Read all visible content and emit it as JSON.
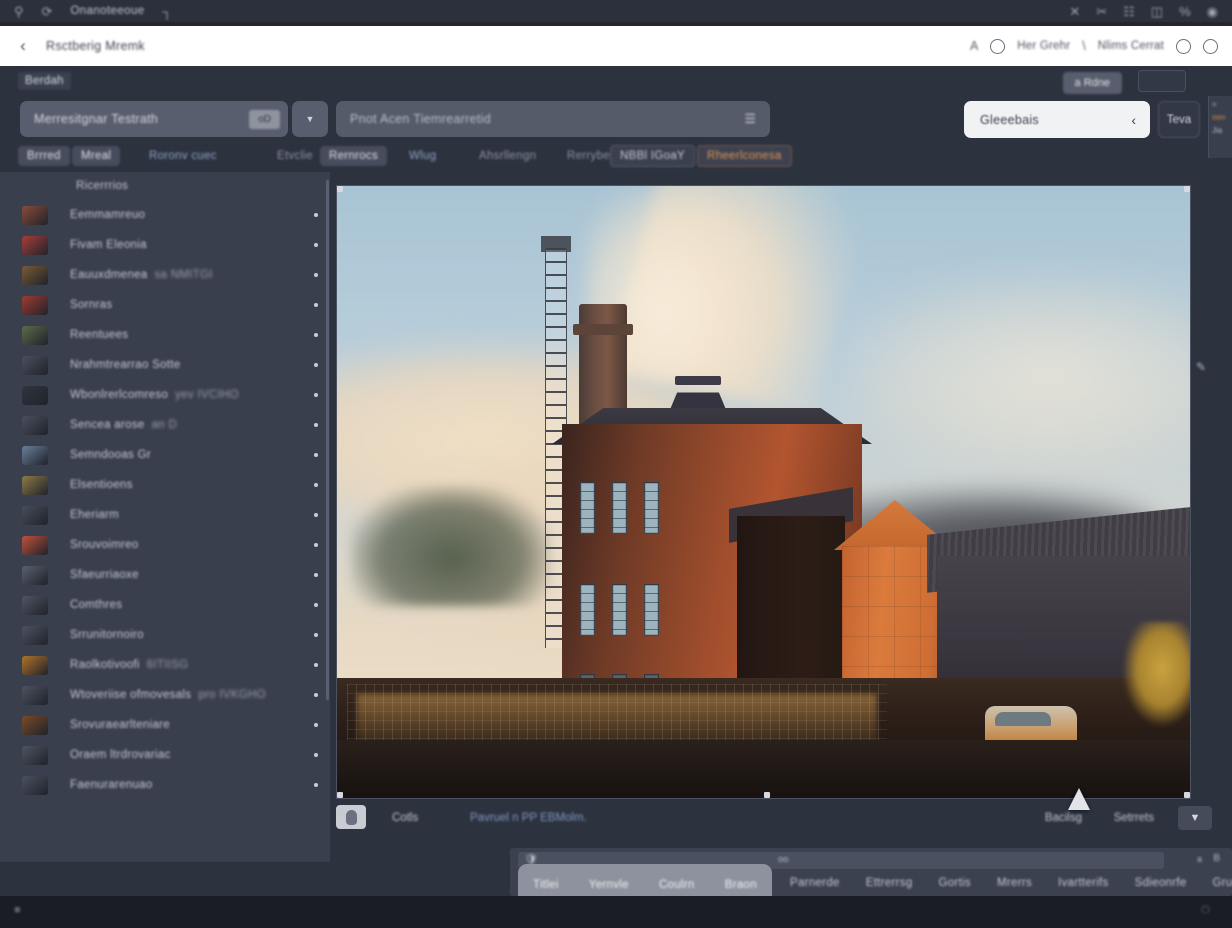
{
  "os_bar": {
    "icons": [
      "search-icon",
      "refresh-icon",
      "window-icon"
    ],
    "label": "Onanoteeoue",
    "right_icons": [
      "cut-icon",
      "scissors-icon",
      "copy-icon",
      "paste-icon",
      "percent-icon",
      "power-icon"
    ]
  },
  "chrome": {
    "back_icon": "chevron-left-icon",
    "title": "Rsctberig Mremk",
    "right": {
      "letter_icon": "A",
      "circle1": "circle-icon",
      "label1": "Her Grehr",
      "slash_icon": "slash-icon",
      "label2": "Nlims Cerrat",
      "circle2": "circle-icon",
      "circle3": "circle-icon"
    }
  },
  "breadcrumb": "Berdah",
  "top_right": {
    "pill": "a Rdne",
    "box": ""
  },
  "toolbar": {
    "search_placeholder": "Merresitgnar Testrath",
    "search_badge": "oD",
    "dropdown_caret": "chevron-down-icon",
    "filter_placeholder": "Pnot Acen Tiemrearretid",
    "filter_icon": "list-icon",
    "select_label": "Gleeebais",
    "select_chevron": "chevron-left-icon",
    "select_button": "Teva"
  },
  "tabs": [
    {
      "label": "Brrred",
      "style": "chip"
    },
    {
      "label": "Mreal",
      "style": "chip"
    },
    {
      "label": "Roronv cuec",
      "style": "link"
    },
    {
      "label": "Etvclie",
      "style": "dim"
    },
    {
      "label": "Rernrocs",
      "style": "chip"
    },
    {
      "label": "Wlug",
      "style": "link"
    },
    {
      "label": "Ahsrllengn",
      "style": "dim"
    },
    {
      "label": "Rerrybes",
      "style": "dim"
    },
    {
      "label": "NBBl IGoaY",
      "style": "outline"
    },
    {
      "label": "Rheerlconesa",
      "style": "accent"
    }
  ],
  "sidebar": {
    "header": "Ricerrrios",
    "items": [
      {
        "label": "Eemmamreuo",
        "thumb": "#8a4b3a",
        "has_thumb": true
      },
      {
        "label": "Fivam Eleonia",
        "thumb": "#a83d3a",
        "has_thumb": true
      },
      {
        "label": "Eauuxdmenea",
        "sub": "sa NMITGI",
        "thumb": "#7a5a34",
        "has_thumb": true
      },
      {
        "label": "Sornras",
        "thumb": "#9e3b30",
        "has_thumb": true
      },
      {
        "label": "Reentuees",
        "thumb": "#5c6b4a",
        "has_thumb": true
      },
      {
        "label": "Nrahmtrearrao Sotte",
        "thumb": "#4a505e",
        "has_thumb": true
      },
      {
        "label": "Wbonlrerlcomreso",
        "sub": "yev IVCIHO",
        "thumb": "#2f3541",
        "has_thumb": true
      },
      {
        "label": "Sencea arose",
        "sub": "an  D",
        "thumb": "#4a505e",
        "has_thumb": true
      },
      {
        "label": "Semndooas  Gr",
        "thumb": "#6a7f9a",
        "has_thumb": true
      },
      {
        "label": "Elsentioens",
        "thumb": "#8d7a46",
        "has_thumb": true
      },
      {
        "label": "Eheriarm",
        "thumb": "#474d5b",
        "has_thumb": true
      },
      {
        "label": "Srouvoimreo",
        "thumb": "#c0503a",
        "has_thumb": true
      },
      {
        "label": "Sfaeurriaoxe",
        "thumb": "#5a6070",
        "has_thumb": true
      },
      {
        "label": "Comthres",
        "thumb": "#4f5563",
        "has_thumb": true
      },
      {
        "label": "Srrunitornoiro",
        "thumb": "#4c5260",
        "has_thumb": true
      },
      {
        "label": "Raolkotivoofi",
        "sub": "6ITIISG",
        "thumb": "#b07328",
        "has_thumb": true
      },
      {
        "label": "Wtoveriise ofmovesals",
        "sub": "pro IVKGHO",
        "thumb": "#4d5361",
        "has_thumb": true
      },
      {
        "label": "Srovuraearlteniare",
        "thumb": "#7a4a28",
        "has_thumb": true
      },
      {
        "label": "Oraem ltrdrovariac",
        "thumb": "#4e5462",
        "has_thumb": true
      },
      {
        "label": "Faenurarenuao",
        "thumb": "#4b5160",
        "has_thumb": true
      }
    ]
  },
  "viewer": {
    "photo_alt": "industrial-brick-factory-with-smokestack-at-sunset",
    "edit_icon": "pencil-icon",
    "footer": {
      "avatar_icon": "avatar-icon",
      "label1": "Cotls",
      "label2": "Pavruel n PP EBMolm.",
      "right1": "Bacilsg",
      "right2": "Setrrets",
      "chevron": "chevron-down-icon"
    }
  },
  "bottom_bar": {
    "shield_icon": "shield-icon",
    "field_number": "oo",
    "mini_left": "a",
    "mini_right": "B",
    "items": [
      "Parnerde",
      "Ettrerrsg",
      "Gortis",
      "Mrerrs",
      "Ivartterifs",
      "Sdieonrfe",
      "Grunntbt"
    ],
    "heart_icon": "heart-icon"
  },
  "popup": {
    "items": [
      "Titlei",
      "Yernvle",
      "Coulrn",
      "Braon"
    ]
  },
  "edge_panel": {
    "line1": "=",
    "line2": "mm",
    "line3": "Jia"
  },
  "colors": {
    "app_bg": "#2d323f",
    "sidebar_bg": "#3a3f4d",
    "chrome_bg": "#ffffff",
    "accent_orange": "#e0954f",
    "link_blue": "#8ea4c4",
    "dropdown_bg": "#f1f2f4"
  }
}
